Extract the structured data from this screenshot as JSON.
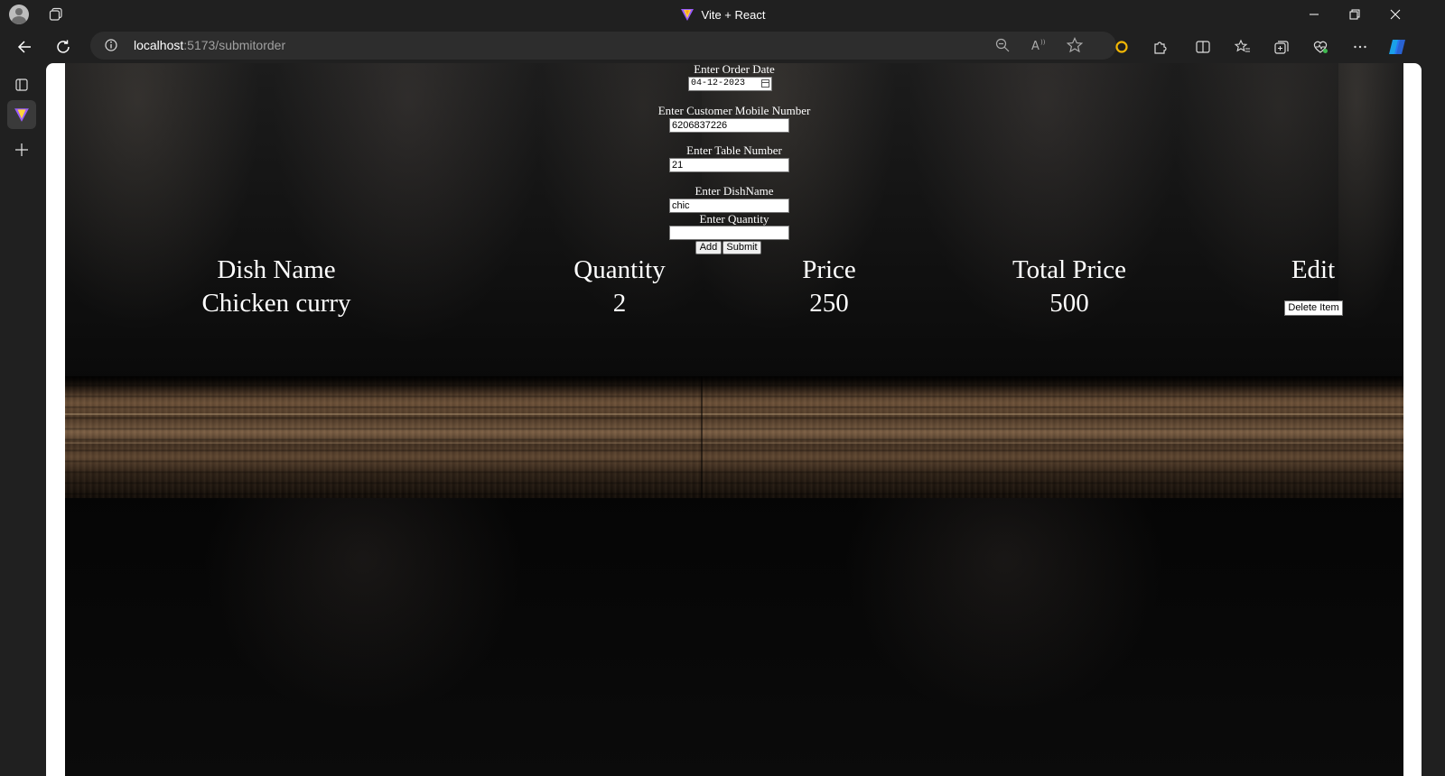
{
  "browser": {
    "window_title": "Vite + React",
    "url_host": "localhost",
    "url_path": ":5173/submitorder"
  },
  "form": {
    "order_date_label": "Enter Order Date",
    "order_date_value": "04-12-2023",
    "mobile_label": "Enter Customer Mobile Number",
    "mobile_value": "6206837226",
    "table_label": "Enter Table Number",
    "table_value": "21",
    "dish_label": "Enter DishName",
    "dish_value": "chic",
    "quantity_label": "Enter Quantity",
    "quantity_value": "",
    "add_label": "Add",
    "submit_label": "Submit"
  },
  "table": {
    "headers": [
      "Dish Name",
      "Quantity",
      "Price",
      "Total Price",
      "Edit"
    ],
    "rows": [
      {
        "dish": "Chicken curry",
        "quantity": "2",
        "price": "250",
        "total": "500",
        "action": "Delete Item"
      }
    ]
  },
  "colors": {
    "chrome_bg": "#202020",
    "urlbar_bg": "#2d2d2d",
    "page_bg": "#050505",
    "text": "#ffffff"
  }
}
